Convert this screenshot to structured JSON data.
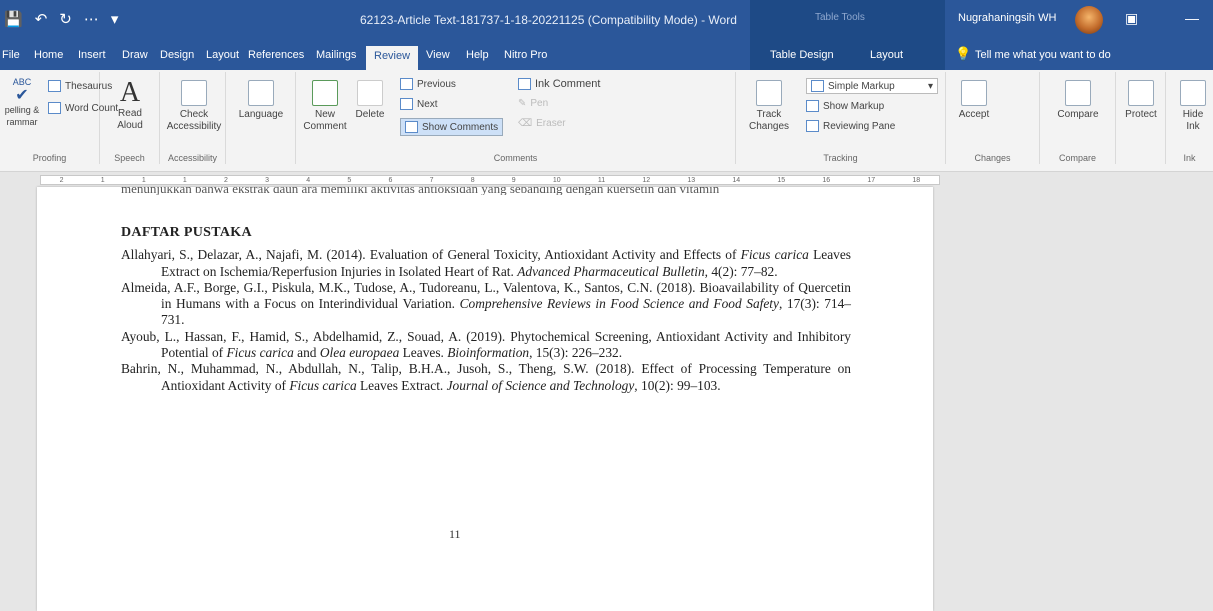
{
  "titlebar": {
    "qat": [
      "💾",
      "↶",
      "↻",
      "⋯",
      "▾"
    ],
    "title": "62123-Article Text-181737-1-18-20221125 (Compatibility Mode) - Word",
    "tabletools": "Table Tools",
    "user": "Nugrahaningsih WH",
    "icon1": "▣",
    "icon2": "—"
  },
  "tabs": [
    "File",
    "Home",
    "Insert",
    "Draw",
    "Design",
    "Layout",
    "References",
    "Mailings",
    "Review",
    "View",
    "Help",
    "Nitro Pro",
    "Table Design",
    "Layout"
  ],
  "tell_me": "Tell me what you want to do",
  "ribbon": {
    "proofing": {
      "spelling": "pelling & rammar",
      "thesaurus": "Thesaurus",
      "wordcount": "Word Count",
      "label": "Proofing",
      "abc": "ABC"
    },
    "speech": {
      "read": "Read Aloud",
      "label": "Speech"
    },
    "accessibility": {
      "check": "Check Accessibility",
      "label": "Accessibility"
    },
    "language": {
      "btn": "Language"
    },
    "comments": {
      "new": "New Comment",
      "delete": "Delete",
      "previous": "Previous",
      "next": "Next",
      "show": "Show Comments",
      "ink": "Ink Comment",
      "pen": "Pen",
      "eraser": "Eraser",
      "label": "Comments"
    },
    "tracking": {
      "track": "Track Changes",
      "markup": "Simple Markup",
      "show_markup": "Show Markup",
      "reviewing": "Reviewing Pane",
      "label": "Tracking"
    },
    "changes": {
      "accept": "Accept",
      "label": "Changes"
    },
    "compare": {
      "btn": "Compare",
      "label": "Compare"
    },
    "protect": {
      "btn": "Protect"
    },
    "ink": {
      "btn": "Hide Ink",
      "label": "Ink"
    }
  },
  "ruler": [
    "2",
    "1",
    "1",
    "1",
    "2",
    "3",
    "4",
    "5",
    "6",
    "7",
    "8",
    "9",
    "10",
    "11",
    "12",
    "13",
    "14",
    "15",
    "16",
    "17",
    "18"
  ],
  "document": {
    "cutoff": "menunjukkan bahwa ekstrak daun ara memiliki aktivitas antioksidan yang sebanding dengan kuersetin dan vitamin",
    "heading": "DAFTAR PUSTAKA",
    "refs": [
      {
        "a": "Allahyari, S., Delazar, A., Najafi, M. (2014). Evaluation of General Toxicity, Antioxidant Activity and Effects of ",
        "b": "Ficus carica",
        "c": " Leaves Extract on Ischemia/Reperfusion Injuries in Isolated Heart of Rat. ",
        "d": "Advanced Pharmaceutical Bulletin",
        "e": ", 4(2): 77–82."
      },
      {
        "a": "Almeida, A.F., Borge, G.I., Piskula, M.K., Tudose, A., Tudoreanu, L., Valentova, K., Santos, C.N. (2018). Bioavailability of Quercetin in Humans with a Focus on Interindividual Variation. ",
        "b": "",
        "c": "",
        "d": "Comprehensive Reviews in Food Science and Food Safety",
        "e": ", 17(3): 714–731."
      },
      {
        "a": "Ayoub, L., Hassan, F., Hamid, S., Abdelhamid, Z., Souad, A. (2019). Phytochemical Screening, Antioxidant Activity and Inhibitory Potential of ",
        "b": "Ficus carica",
        "c": " and ",
        "b2": "Olea europaea",
        "c2": " Leaves. ",
        "d": "Bioinformation",
        "e": ", 15(3): 226–232."
      },
      {
        "a": "Bahrin, N., Muhammad, N., Abdullah, N., Talip, B.H.A., Jusoh, S., Theng, S.W. (2018). Effect of Processing Temperature on Antioxidant Activity of ",
        "b": "Ficus carica",
        "c": " Leaves Extract. ",
        "d": "Journal of Science and Technology",
        "e": ", 10(2): 99–103."
      }
    ],
    "page_number": "11"
  }
}
